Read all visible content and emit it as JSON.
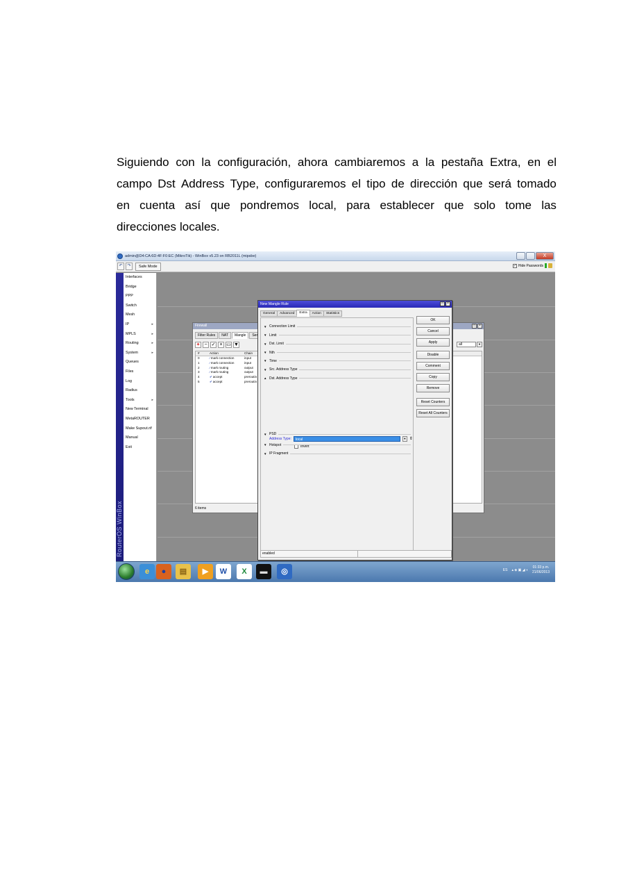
{
  "paragraph": {
    "lines": [
      [
        "Siguiendo",
        "con",
        "la",
        "configuración,",
        "ahora",
        "cambiaremos",
        "a",
        "la",
        "pestaña",
        "Extra,",
        "en",
        "el"
      ],
      [
        "campo",
        "Dst",
        "Address",
        "Type,",
        "configuraremos",
        "el",
        "tipo",
        "de",
        "dirección",
        "que",
        "será",
        "tomado"
      ],
      [
        "en",
        "cuenta",
        "así",
        "que",
        "pondremos",
        "local,",
        "para",
        "establecer",
        "que",
        "solo",
        "tome",
        "las"
      ],
      [
        "direcciones",
        "locales."
      ]
    ]
  },
  "window": {
    "title": "admin@D4:CA:6D:4F:F0:EC (MikroTik) - WinBox v5.23 on RB2011L (mipsbe)",
    "close_label": "X",
    "safe_mode": "Safe Mode",
    "hide_passwords": "Hide Passwords",
    "hide_passwords_checked": "✓"
  },
  "sidebar": {
    "brand": "RouterOS WinBox",
    "items": [
      {
        "label": "Interfaces",
        "arrow": ""
      },
      {
        "label": "Bridge",
        "arrow": ""
      },
      {
        "label": "PPP",
        "arrow": ""
      },
      {
        "label": "Switch",
        "arrow": ""
      },
      {
        "label": "Mesh",
        "arrow": ""
      },
      {
        "label": "IP",
        "arrow": "▸"
      },
      {
        "label": "MPLS",
        "arrow": "▸"
      },
      {
        "label": "Routing",
        "arrow": "▸"
      },
      {
        "label": "System",
        "arrow": "▸"
      },
      {
        "label": "Queues",
        "arrow": ""
      },
      {
        "label": "Files",
        "arrow": ""
      },
      {
        "label": "Log",
        "arrow": ""
      },
      {
        "label": "Radius",
        "arrow": ""
      },
      {
        "label": "Tools",
        "arrow": "▸"
      },
      {
        "label": "New Terminal",
        "arrow": ""
      },
      {
        "label": "MetaROUTER",
        "arrow": ""
      },
      {
        "label": "Make Supout.rif",
        "arrow": ""
      },
      {
        "label": "Manual",
        "arrow": ""
      },
      {
        "label": "Exit",
        "arrow": ""
      }
    ]
  },
  "firewall": {
    "title": "Firewall",
    "tabs": [
      "Filter Rules",
      "NAT",
      "Mangle",
      "Service Ports"
    ],
    "active_tab": "Mangle",
    "columns": [
      "#",
      "Action",
      "Chain"
    ],
    "rows": [
      {
        "n": "0",
        "action": "mark connection",
        "chain": "input"
      },
      {
        "n": "1",
        "action": "mark connection",
        "chain": "input"
      },
      {
        "n": "2",
        "action": "mark routing",
        "chain": "output"
      },
      {
        "n": "3",
        "action": "mark routing",
        "chain": "output"
      },
      {
        "n": "4",
        "action": "accept",
        "chain": "preroutin"
      },
      {
        "n": "5",
        "action": "accept",
        "chain": "preroutin"
      }
    ],
    "filter_value": "all",
    "status": "6 items"
  },
  "dialog": {
    "title": "New Mangle Rule",
    "tabs": [
      "General",
      "Advanced",
      "Extra",
      "Action",
      "Statistics"
    ],
    "active_tab": "Extra",
    "sections": [
      {
        "label": "Connection Limit",
        "expanded": false
      },
      {
        "label": "Limit",
        "expanded": false
      },
      {
        "label": "Dst. Limit",
        "expanded": false
      },
      {
        "label": "Nth",
        "expanded": false
      },
      {
        "label": "Time",
        "expanded": false
      },
      {
        "label": "Src. Address Type",
        "expanded": false
      },
      {
        "label": "Dst. Address Type",
        "expanded": true
      },
      {
        "label": "PSD",
        "expanded": false
      },
      {
        "label": "Hotspot",
        "expanded": false
      },
      {
        "label": "IP Fragment",
        "expanded": false
      }
    ],
    "address_type_label": "Address Type:",
    "address_type_value": "local",
    "invert_label": "Invert",
    "buttons": [
      "OK",
      "Cancel",
      "Apply",
      "Disable",
      "Comment",
      "Copy",
      "Remove",
      "Reset Counters",
      "Reset All Counters"
    ],
    "status": "enabled"
  },
  "taskbar": {
    "apps": [
      {
        "name": "ie",
        "glyph": "e",
        "bg": "#3b8fd8",
        "fg": "#ffd54a"
      },
      {
        "name": "firefox",
        "glyph": "●",
        "bg": "#d9621e",
        "fg": "#1f3f9c"
      },
      {
        "name": "explorer",
        "glyph": "▤",
        "bg": "#e8c14a",
        "fg": "#8a6414"
      },
      {
        "name": "media",
        "glyph": "▶",
        "bg": "#f0a020",
        "fg": "#ffffff"
      },
      {
        "name": "word",
        "glyph": "W",
        "bg": "#ffffff",
        "fg": "#1f4fa8"
      },
      {
        "name": "excel",
        "glyph": "X",
        "bg": "#ffffff",
        "fg": "#1e8a3c"
      },
      {
        "name": "cmd",
        "glyph": "▬",
        "bg": "#111111",
        "fg": "#dddddd"
      },
      {
        "name": "winbox",
        "glyph": "◎",
        "bg": "#2f6ac2",
        "fg": "#ffffff"
      }
    ],
    "lang": "ES",
    "time": "01:33 p.m.",
    "date": "21/06/2013"
  }
}
